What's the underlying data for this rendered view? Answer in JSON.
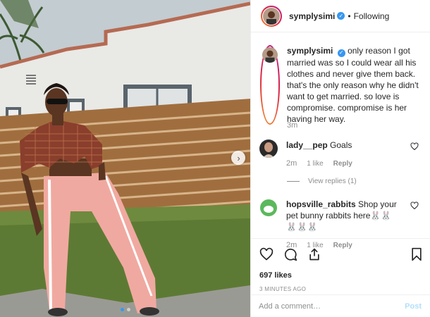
{
  "post": {
    "username": "symplysimi",
    "follow_status": "Following",
    "separator": "•",
    "caption": "only reason I got married was so I could wear all his clothes and never give them back. that's the only reason why he didn't want to get married. so love is compromise. compromise is her having her way.",
    "caption_time": "3m",
    "likes": "697 likes",
    "posted_ago": "3 MINUTES AGO"
  },
  "comments": [
    {
      "username": "lady__pep",
      "text": "Goals",
      "time": "2m",
      "likes": "1 like",
      "reply_label": "Reply",
      "view_replies": "View replies (1)"
    },
    {
      "username": "hopsville_rabbits",
      "text": "Shop your pet bunny rabbits here🐰🐰🐰🐰🐰",
      "time": "2m",
      "likes": "1 like",
      "reply_label": "Reply"
    }
  ],
  "composer": {
    "placeholder": "Add a comment…",
    "post_label": "Post"
  },
  "icons": {
    "verified": "verified-badge",
    "like": "heart-icon",
    "comment": "comment-icon",
    "share": "share-icon",
    "save": "bookmark-icon",
    "next": "chevron-right-icon"
  },
  "carousel": {
    "current_index": 1,
    "count": 2
  },
  "colors": {
    "link_blue": "#3897f0",
    "post_disabled": "#b2dffc",
    "muted": "#8e8e8e"
  }
}
